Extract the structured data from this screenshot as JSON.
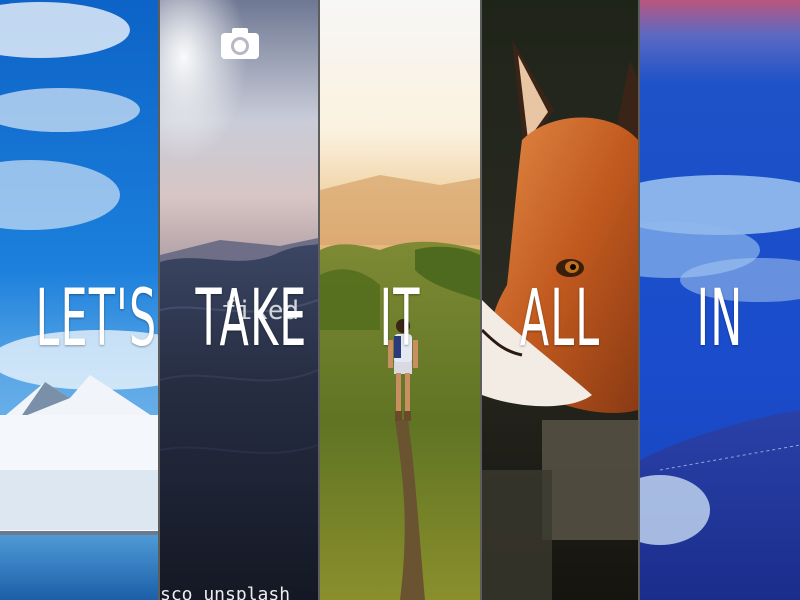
{
  "panels": [
    {
      "word": "LET'S",
      "scene": "mountain-lake-sky"
    },
    {
      "word": "TAKE",
      "scene": "ocean-wave-sunset"
    },
    {
      "word": "IT",
      "scene": "hiker-ridge-trail"
    },
    {
      "word": "ALL",
      "scene": "red-fox-closeup"
    },
    {
      "word": "IN",
      "scene": "blue-sky-clouds-hill"
    }
  ],
  "overlay": {
    "camera_icon": "camera-icon",
    "ghost_word": "fiked",
    "credit_text": "sco unsplash"
  },
  "colors": {
    "sky_blue": "#1a78d4",
    "deep_blue": "#1440b8",
    "ocean_navy": "#1e2433",
    "fox_orange": "#c2561f",
    "grass_green": "#6f8a2a"
  }
}
